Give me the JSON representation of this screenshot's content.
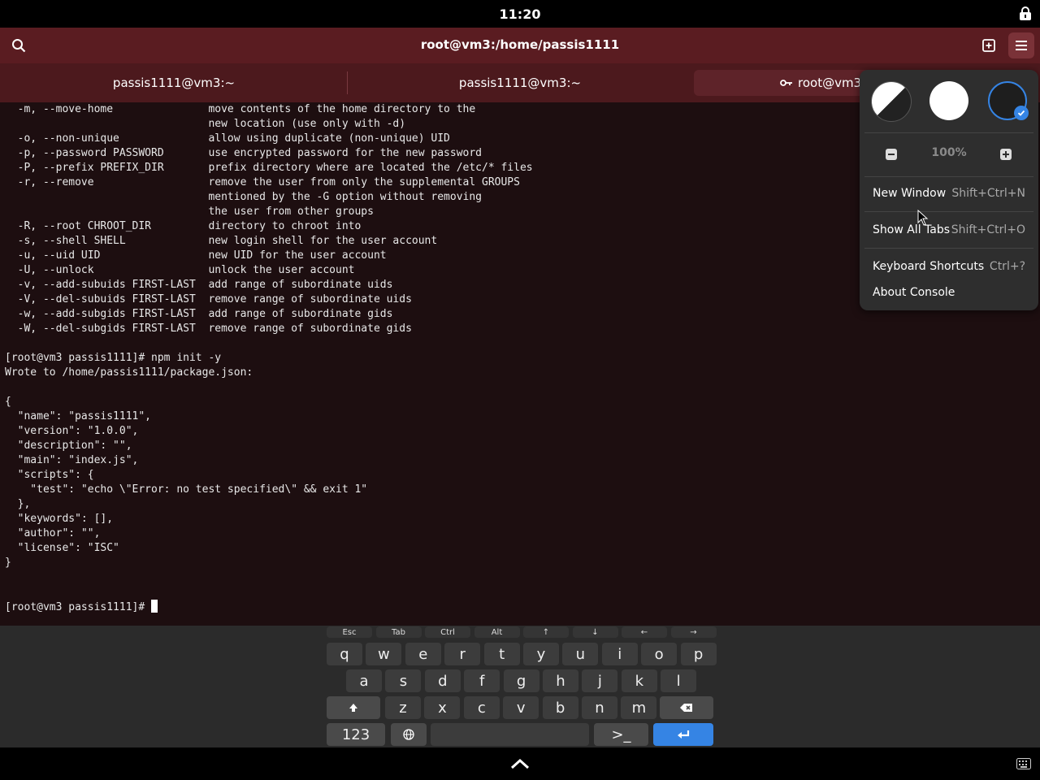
{
  "status_bar": {
    "time": "11:20"
  },
  "window": {
    "title": "root@vm3:/home/passis1111",
    "icons": {
      "search": "search-icon",
      "new_tab": "new-tab-icon",
      "menu": "hamburger-menu-icon",
      "lock": "lock-icon"
    }
  },
  "tabs": [
    {
      "label": "passis1111@vm3:~"
    },
    {
      "label": "passis1111@vm3:~"
    },
    {
      "label": "root@vm3:",
      "icon": "key-icon",
      "active": true
    }
  ],
  "terminal": {
    "lines": [
      "  -m, --move-home               move contents of the home directory to the",
      "                                new location (use only with -d)",
      "  -o, --non-unique              allow using duplicate (non-unique) UID",
      "  -p, --password PASSWORD       use encrypted password for the new password",
      "  -P, --prefix PREFIX_DIR       prefix directory where are located the /etc/* files",
      "  -r, --remove                  remove the user from only the supplemental GROUPS",
      "                                mentioned by the -G option without removing",
      "                                the user from other groups",
      "  -R, --root CHROOT_DIR         directory to chroot into",
      "  -s, --shell SHELL             new login shell for the user account",
      "  -u, --uid UID                 new UID for the user account",
      "  -U, --unlock                  unlock the user account",
      "  -v, --add-subuids FIRST-LAST  add range of subordinate uids",
      "  -V, --del-subuids FIRST-LAST  remove range of subordinate uids",
      "  -w, --add-subgids FIRST-LAST  add range of subordinate gids",
      "  -W, --del-subgids FIRST-LAST  remove range of subordinate gids",
      "",
      "[root@vm3 passis1111]# npm init -y",
      "Wrote to /home/passis1111/package.json:",
      "",
      "{",
      "  \"name\": \"passis1111\",",
      "  \"version\": \"1.0.0\",",
      "  \"description\": \"\",",
      "  \"main\": \"index.js\",",
      "  \"scripts\": {",
      "    \"test\": \"echo \\\"Error: no test specified\\\" && exit 1\"",
      "  },",
      "  \"keywords\": [],",
      "  \"author\": \"\",",
      "  \"license\": \"ISC\"",
      "}",
      "",
      ""
    ],
    "prompt": "[root@vm3 passis1111]# "
  },
  "menu": {
    "styles": [
      "follow-system-style",
      "light-style",
      "dark-style"
    ],
    "selected_style": "dark-style",
    "zoom": "100%",
    "items": [
      {
        "label": "New Window",
        "shortcut": "Shift+Ctrl+N"
      },
      {
        "label": "Show All Tabs",
        "shortcut": "Shift+Ctrl+O"
      },
      {
        "label": "Keyboard Shortcuts",
        "shortcut": "Ctrl+?"
      },
      {
        "label": "About Console",
        "shortcut": ""
      }
    ]
  },
  "keyboard": {
    "special_row": [
      "Esc",
      "Tab",
      "Ctrl",
      "Alt",
      "↑",
      "↓",
      "←",
      "→"
    ],
    "row1": [
      "q",
      "w",
      "e",
      "r",
      "t",
      "y",
      "u",
      "i",
      "o",
      "p"
    ],
    "row2": [
      "a",
      "s",
      "d",
      "f",
      "g",
      "h",
      "j",
      "k",
      "l"
    ],
    "row3": [
      "z",
      "x",
      "c",
      "v",
      "b",
      "n",
      "m"
    ],
    "numbers_label": "123",
    "terminal_label": ">_",
    "accent_color": "#3584e4"
  },
  "colors": {
    "header_bg": "#5a1c21",
    "tabbar_bg": "#4c191d",
    "terminal_bg": "#1d0e10"
  }
}
